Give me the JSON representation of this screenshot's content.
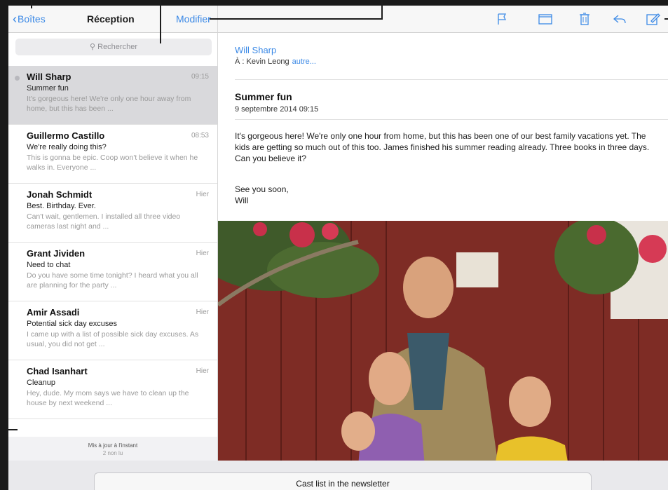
{
  "nav": {
    "back_label": "Boîtes",
    "title": "Réception",
    "edit_label": "Modifier"
  },
  "toolbar": {
    "icons": [
      "flag-icon",
      "folder-icon",
      "trash-icon",
      "reply-icon",
      "compose-icon"
    ],
    "accent": "#3b89e6"
  },
  "search": {
    "placeholder": "Rechercher"
  },
  "mails": [
    {
      "sender": "Will Sharp",
      "time": "09:15",
      "subject": "Summer fun",
      "preview": "It's gorgeous here! We're only one hour away from home, but this has been ...",
      "selected": true
    },
    {
      "sender": "Guillermo Castillo",
      "time": "08:53",
      "subject": "We're really doing this?",
      "preview": "This is gonna be epic. Coop won't believe it when he walks in. Everyone ..."
    },
    {
      "sender": "Jonah Schmidt",
      "time": "Hier",
      "subject": "Best. Birthday. Ever.",
      "preview": "Can't wait, gentlemen. I installed all three video cameras last night and ..."
    },
    {
      "sender": "Grant Jividen",
      "time": "Hier",
      "subject": "Need to chat",
      "preview": "Do you have some time tonight? I heard what you all are planning for the party ..."
    },
    {
      "sender": "Amir Assadi",
      "time": "Hier",
      "subject": "Potential sick day excuses",
      "preview": "I came up with a list of possible sick day excuses. As usual, you did not get ..."
    },
    {
      "sender": "Chad Isanhart",
      "time": "Hier",
      "subject": "Cleanup",
      "preview": "Hey, dude. My mom says we have to clean up the house by next weekend ..."
    }
  ],
  "list_footer": {
    "line1": "Mis à jour à l'instant",
    "line2": "2 non lu"
  },
  "message": {
    "from": "Will Sharp",
    "to_prefix": "À : Kevin Leong",
    "to_more": "autre...",
    "subject": "Summer fun",
    "date": "9 septembre 2014 09:15",
    "body": "It's gorgeous here! We're only one hour from home, but this has been one of our best family vacations yet. The kids are getting so much out of this too. James finished his summer reading already. Three books in three days. Can you believe it?",
    "signoff_1": "See you soon,",
    "signoff_2": "Will"
  },
  "bottom_sheet": {
    "title": "Cast list in the newsletter"
  }
}
